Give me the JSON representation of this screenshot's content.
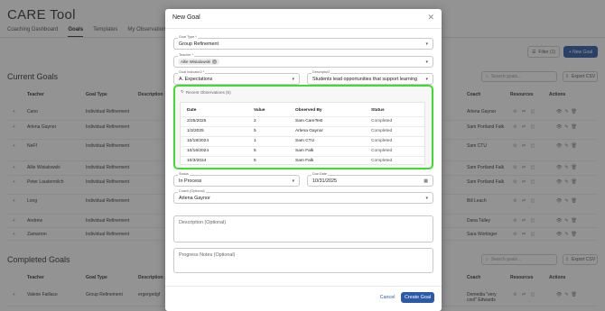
{
  "app": {
    "title": "CARE Tool",
    "tabs": [
      "Coaching Dashboard",
      "Goals",
      "Templates",
      "My Observations"
    ],
    "active_tab": "Goals"
  },
  "toolbar": {
    "filter_label": "Filter (1)",
    "new_goal_label": "+ New Goal"
  },
  "current_goals": {
    "title": "Current Goals",
    "search_placeholder": "Search goals...",
    "export_label": "Export CSV",
    "columns": [
      "Teacher",
      "Goal Type",
      "Description",
      "Coach",
      "Resources",
      "Actions"
    ],
    "rows": [
      {
        "teacher": "Cano",
        "goal_type": "Individual Refinement",
        "coach": "Arlena Gaynor"
      },
      {
        "teacher": "Arlena Gaynor",
        "goal_type": "Individual Refinement",
        "coach": "Sam Portland Falk"
      },
      {
        "teacher": "NeFf",
        "goal_type": "Individual Refinement",
        "coach": "Sam CTU"
      },
      {
        "teacher": "Allie Wisialowski",
        "goal_type": "Individual Refinement",
        "coach": "Sam Portland Falk"
      },
      {
        "teacher": "Peter Laudermilch",
        "goal_type": "Individual Refinement",
        "coach": "Sam Portland Falk"
      },
      {
        "teacher": "Long",
        "goal_type": "Individual Refinement",
        "coach": "Bill Leach"
      },
      {
        "teacher": "Andrew",
        "goal_type": "Individual Refinement",
        "coach": "Dana Talley"
      },
      {
        "teacher": "Zamarron",
        "goal_type": "Individual Refinement",
        "coach": "Sara Wortinger"
      }
    ]
  },
  "completed_goals": {
    "title": "Completed Goals",
    "search_placeholder": "Search goals...",
    "export_label": "Export CSV",
    "columns": [
      "Teacher",
      "Goal Type",
      "Description",
      "Coach",
      "Resources",
      "Actions"
    ],
    "rows": [
      {
        "teacher": "Valerie Faillace",
        "goal_type": "Group Refinement",
        "description": "ergergedgf",
        "coach": "Demedia \"very cool\" Edwards"
      }
    ]
  },
  "modal": {
    "title": "New Goal",
    "close_icon": "close-icon",
    "goal_type": {
      "label": "Goal Type *",
      "value": "Group Refinement"
    },
    "teacher": {
      "label": "Teacher *",
      "chip": "Allie Wisialowski"
    },
    "goal_indicator": {
      "label": "Goal Indicator2 *",
      "value": "A. Expectations"
    },
    "descriptor": {
      "label": "Descriptor2",
      "value": "Students lead opportunities that support learning"
    },
    "observations": {
      "title": "Recent Observations (5)",
      "columns": [
        "Date",
        "Value",
        "Observed By",
        "Status"
      ],
      "rows": [
        {
          "date": "2/25/2025",
          "value": "2",
          "observed_by": "Sam CareTest",
          "status": "Completed"
        },
        {
          "date": "1/3/2025",
          "value": "5",
          "observed_by": "Arlena Gaynor",
          "status": "Completed"
        },
        {
          "date": "10/18/2024",
          "value": "1",
          "observed_by": "Sam CTU",
          "status": "Completed"
        },
        {
          "date": "10/16/2024",
          "value": "5",
          "observed_by": "Sam Falk",
          "status": "Completed"
        },
        {
          "date": "10/3/2024",
          "value": "5",
          "observed_by": "Sam Falk",
          "status": "Completed"
        }
      ],
      "highlight_color": "#3ddc2e"
    },
    "status": {
      "label": "Status",
      "value": "In Process"
    },
    "due_date": {
      "label": "Due Date",
      "value": "10/31/2025"
    },
    "coach": {
      "label": "Coach (Optional)",
      "value": "Arlena Gaynor"
    },
    "description": {
      "placeholder": "Description (Optional)"
    },
    "progress_notes": {
      "placeholder": "Progress Notes (Optional)"
    },
    "cancel_label": "Cancel",
    "create_label": "Create Goal"
  },
  "colors": {
    "primary": "#2d5aa6",
    "highlight": "#3ddc2e"
  }
}
